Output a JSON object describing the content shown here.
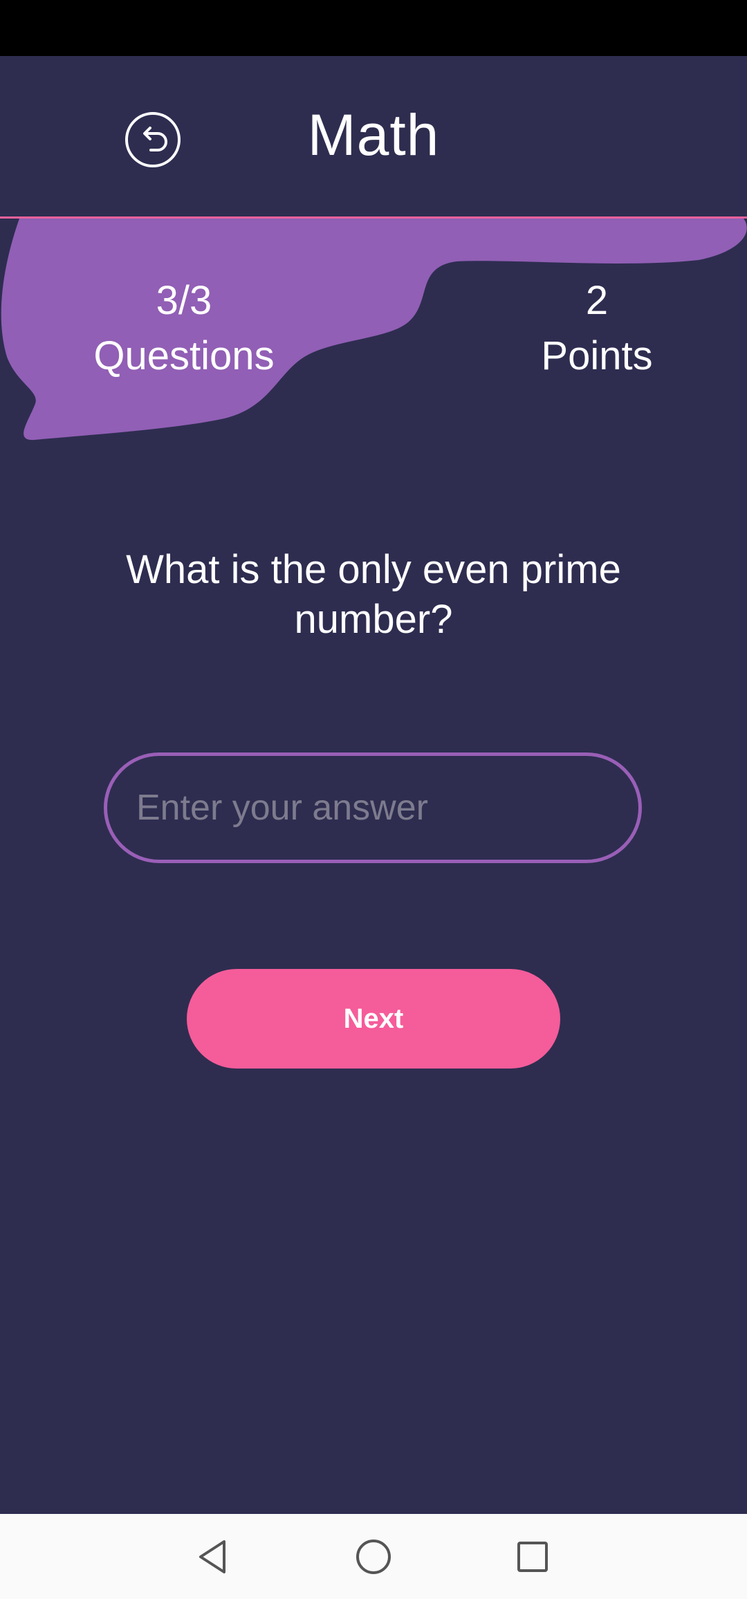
{
  "header": {
    "title": "Math",
    "back_icon": "back-arrow-circle-icon"
  },
  "stats": {
    "questions_value": "3/3",
    "questions_label": "Questions",
    "points_value": "2",
    "points_label": "Points"
  },
  "question": {
    "text": "What is the only even prime number?"
  },
  "answer": {
    "placeholder": "Enter your answer",
    "value": ""
  },
  "actions": {
    "next_label": "Next"
  },
  "colors": {
    "background": "#2e2d50",
    "accent_purple": "#9a5fb7",
    "accent_pink": "#f55c9a",
    "divider": "#f0619c"
  },
  "system_nav": {
    "back_icon": "triangle-back-icon",
    "home_icon": "circle-home-icon",
    "recent_icon": "square-recents-icon"
  }
}
